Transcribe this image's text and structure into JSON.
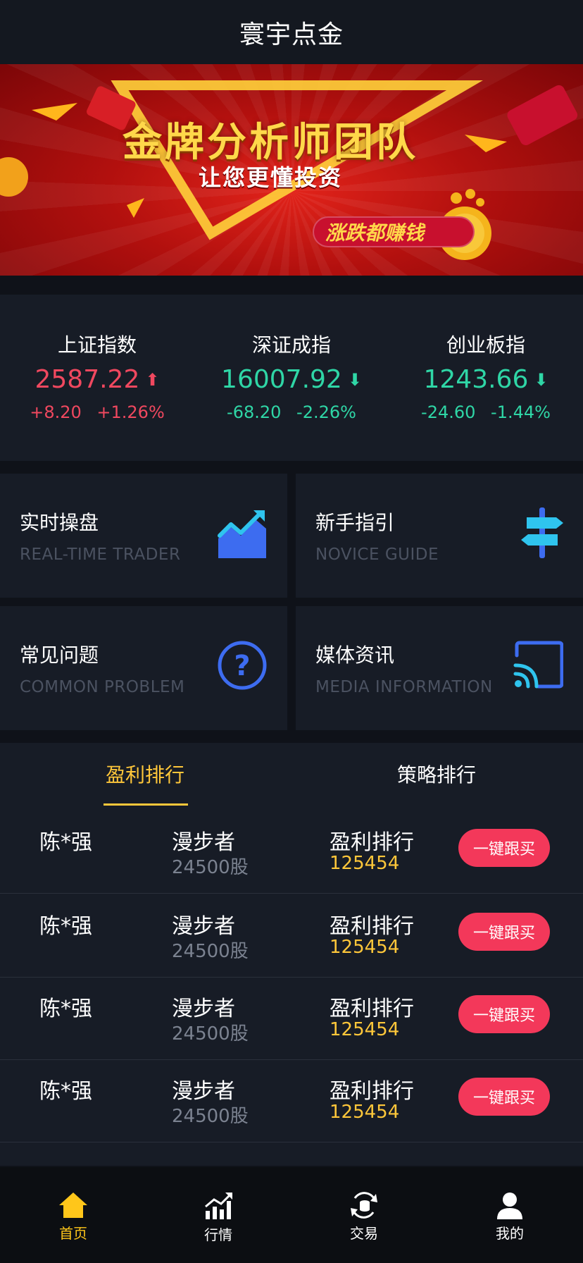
{
  "header": {
    "title": "寰宇点金"
  },
  "banner": {
    "headline": "金牌分析师团队",
    "subline": "让您更懂投资",
    "pill": "涨跌都赚钱"
  },
  "indices": [
    {
      "name": "上证指数",
      "value": "2587.22",
      "change": "+8.20",
      "percent": "+1.26%",
      "direction": "up"
    },
    {
      "name": "深证成指",
      "value": "16007.92",
      "change": "-68.20",
      "percent": "-2.26%",
      "direction": "down"
    },
    {
      "name": "创业板指",
      "value": "1243.66",
      "change": "-24.60",
      "percent": "-1.44%",
      "direction": "down"
    }
  ],
  "features": [
    {
      "title": "实时操盘",
      "subtitle": "REAL-TIME TRADER",
      "icon": "trend-chart-icon"
    },
    {
      "title": "新手指引",
      "subtitle": "NOVICE GUIDE",
      "icon": "signpost-icon"
    },
    {
      "title": "常见问题",
      "subtitle": "COMMON PROBLEM",
      "icon": "question-icon"
    },
    {
      "title": "媒体资讯",
      "subtitle": "MEDIA INFORMATION",
      "icon": "cast-icon"
    }
  ],
  "ranking": {
    "tabs": [
      "盈利排行",
      "策略排行"
    ],
    "active_tab": "盈利排行",
    "rows": [
      {
        "user": "陈*强",
        "nickname": "漫步者",
        "shares": "24500股",
        "label": "盈利排行",
        "value": "125454",
        "button": "一键跟买"
      },
      {
        "user": "陈*强",
        "nickname": "漫步者",
        "shares": "24500股",
        "label": "盈利排行",
        "value": "125454",
        "button": "一键跟买"
      },
      {
        "user": "陈*强",
        "nickname": "漫步者",
        "shares": "24500股",
        "label": "盈利排行",
        "value": "125454",
        "button": "一键跟买"
      },
      {
        "user": "陈*强",
        "nickname": "漫步者",
        "shares": "24500股",
        "label": "盈利排行",
        "value": "125454",
        "button": "一键跟买"
      }
    ]
  },
  "tabbar": [
    {
      "label": "首页",
      "icon": "home-icon",
      "active": true
    },
    {
      "label": "行情",
      "icon": "market-chart-icon",
      "active": false
    },
    {
      "label": "交易",
      "icon": "trade-icon",
      "active": false
    },
    {
      "label": "我的",
      "icon": "user-icon",
      "active": false
    }
  ],
  "colors": {
    "up": "#f0485f",
    "down": "#2fd6a6",
    "accent": "#ffc73a",
    "button": "#f3385a",
    "icon_blue": "#3d6cf0"
  }
}
